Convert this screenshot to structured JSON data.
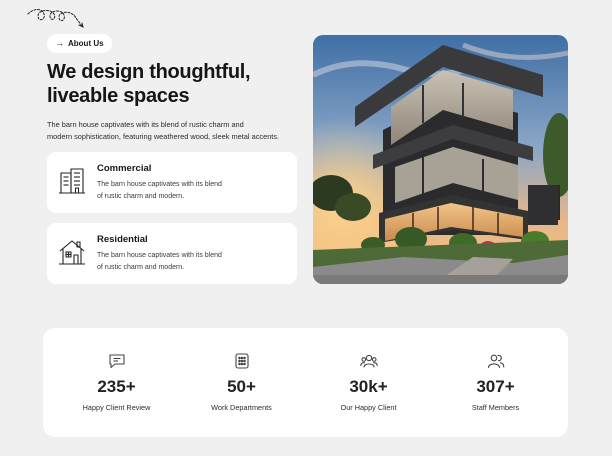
{
  "badge": {
    "label": "About Us",
    "icon": "arrow-right-icon"
  },
  "hero": {
    "headline_line1": "We design thoughtful,",
    "headline_line2": "liveable spaces",
    "intro_line1": "The barn house captivates with its blend of rustic charm and",
    "intro_line2": "modern sophistication, featuring weathered wood, sleek metal accents."
  },
  "services": [
    {
      "title": "Commercial",
      "desc_line1": "The barn house captivates with its blend",
      "desc_line2": "of rustic charm and modern.",
      "icon": "office-building-icon"
    },
    {
      "title": "Residential",
      "desc_line1": "The barn house captivates with its blend",
      "desc_line2": "of rustic charm and modern.",
      "icon": "house-icon"
    }
  ],
  "stats": [
    {
      "value": "235+",
      "label": "Happy Client Review",
      "icon": "chat-bubble-icon"
    },
    {
      "value": "50+",
      "label": "Work Departments",
      "icon": "building-grid-icon"
    },
    {
      "value": "30k+",
      "label": "Our Happy Client",
      "icon": "users-icon"
    },
    {
      "value": "307+",
      "label": "Staff Members",
      "icon": "user-group-icon"
    }
  ],
  "colors": {
    "background": "#f0f0f0",
    "card": "#ffffff",
    "text": "#161616"
  }
}
